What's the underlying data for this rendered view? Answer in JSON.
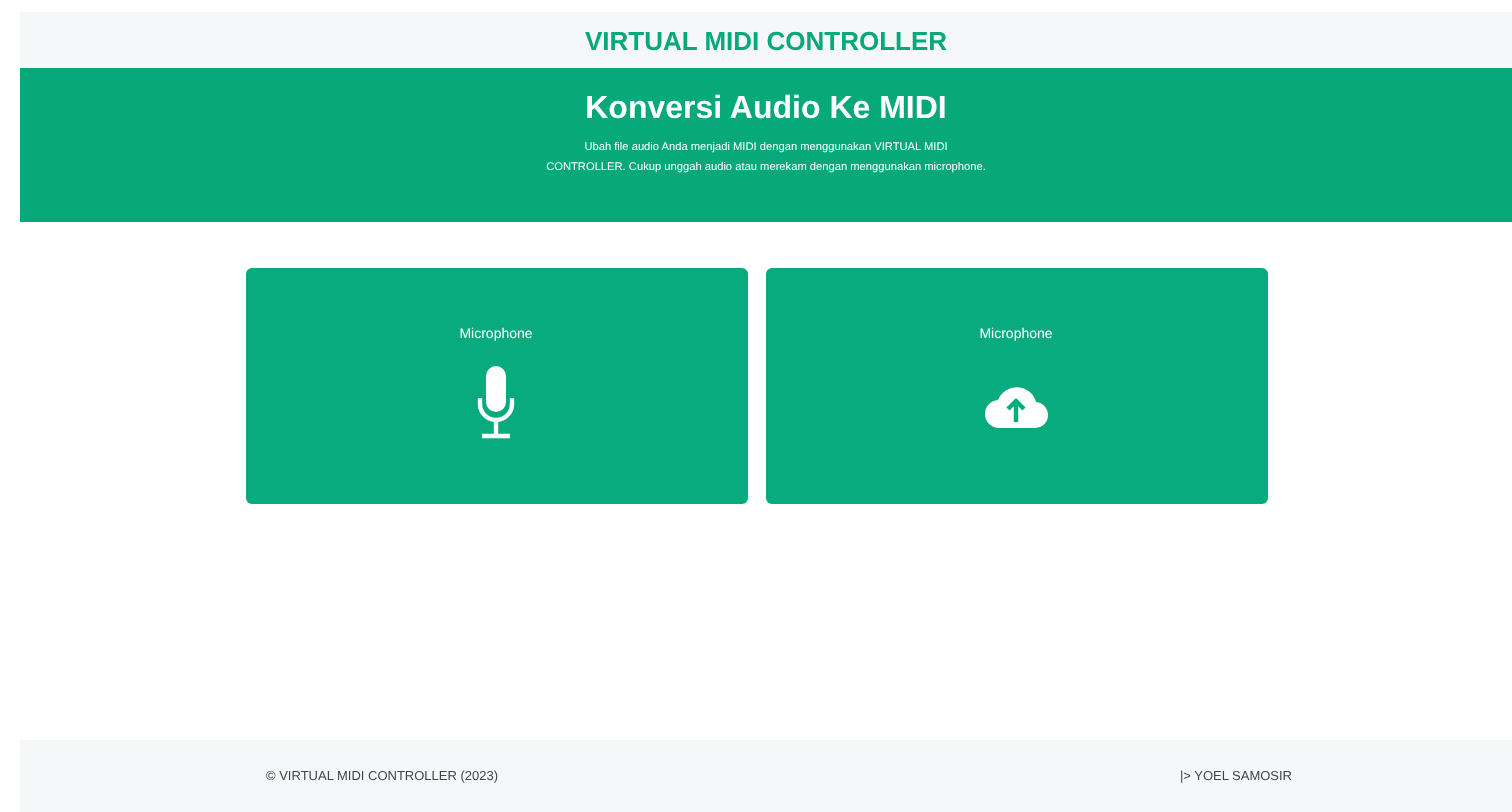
{
  "header": {
    "title": "VIRTUAL MIDI CONTROLLER"
  },
  "hero": {
    "title": "Konversi Audio Ke MIDI",
    "description_lines": [
      "Ubah file audio Anda menjadi MIDI dengan menggunakan VIRTUAL MIDI",
      "CONTROLLER. Cukup unggah audio atau merekam dengan menggunakan microphone."
    ]
  },
  "cards": [
    {
      "label": "Microphone",
      "kind": "microphone"
    },
    {
      "label": "Microphone",
      "kind": "upload"
    }
  ],
  "footer": {
    "copyright": "© VIRTUAL MIDI CONTROLLER (2023)",
    "author": "|> YOEL SAMOSIR"
  }
}
